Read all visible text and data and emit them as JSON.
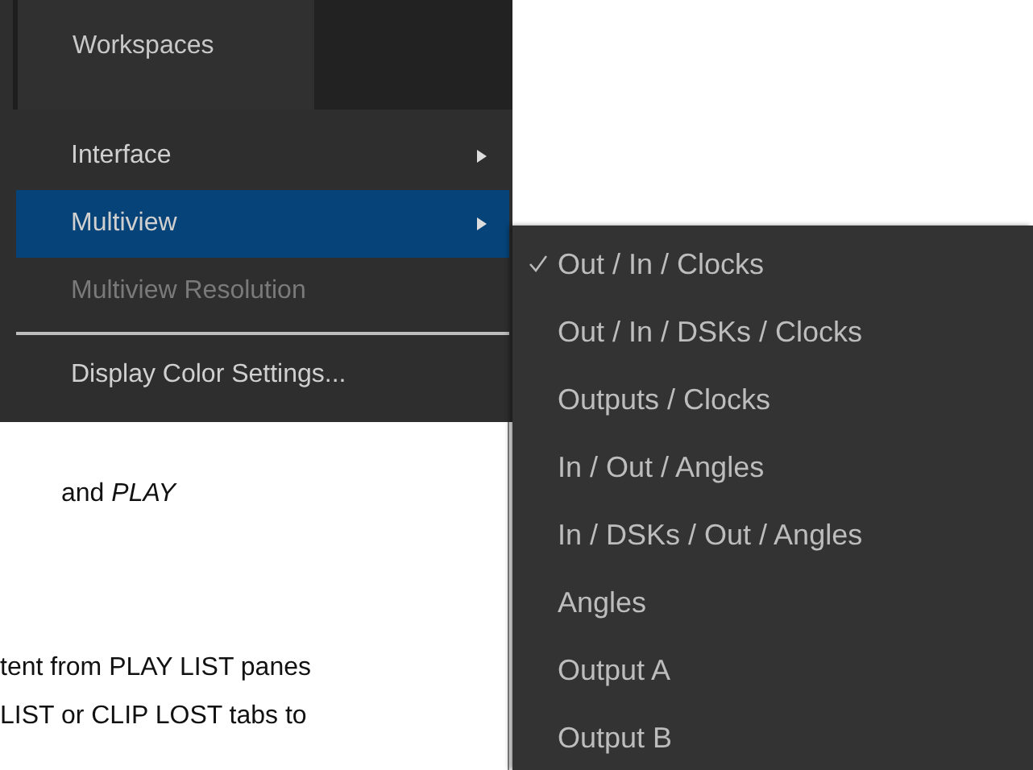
{
  "document": {
    "paragraphs": [
      [
        "and  *PLAY*"
      ],
      [
        "tent from PLAY LIST panes",
        "LIST or CLIP LOST tabs to"
      ]
    ]
  },
  "menu": {
    "header": "Workspaces",
    "items": [
      {
        "kind": "submenu",
        "label": "Interface",
        "selected": false,
        "disabled": false
      },
      {
        "kind": "submenu",
        "label": "Multiview",
        "selected": true,
        "disabled": false
      },
      {
        "kind": "item",
        "label": "Multiview Resolution",
        "selected": false,
        "disabled": true
      },
      {
        "kind": "separator"
      },
      {
        "kind": "item",
        "label": "Display Color Settings...",
        "selected": false,
        "disabled": false
      }
    ]
  },
  "submenu": {
    "items": [
      {
        "label": "Out / In / Clocks",
        "checked": true
      },
      {
        "label": "Out / In / DSKs / Clocks",
        "checked": false
      },
      {
        "label": "Outputs / Clocks",
        "checked": false
      },
      {
        "label": "In / Out / Angles",
        "checked": false
      },
      {
        "label": "In / DSKs / Out / Angles",
        "checked": false
      },
      {
        "label": "Angles",
        "checked": false
      },
      {
        "label": "Output A",
        "checked": false
      },
      {
        "label": "Output B",
        "checked": false
      }
    ]
  }
}
